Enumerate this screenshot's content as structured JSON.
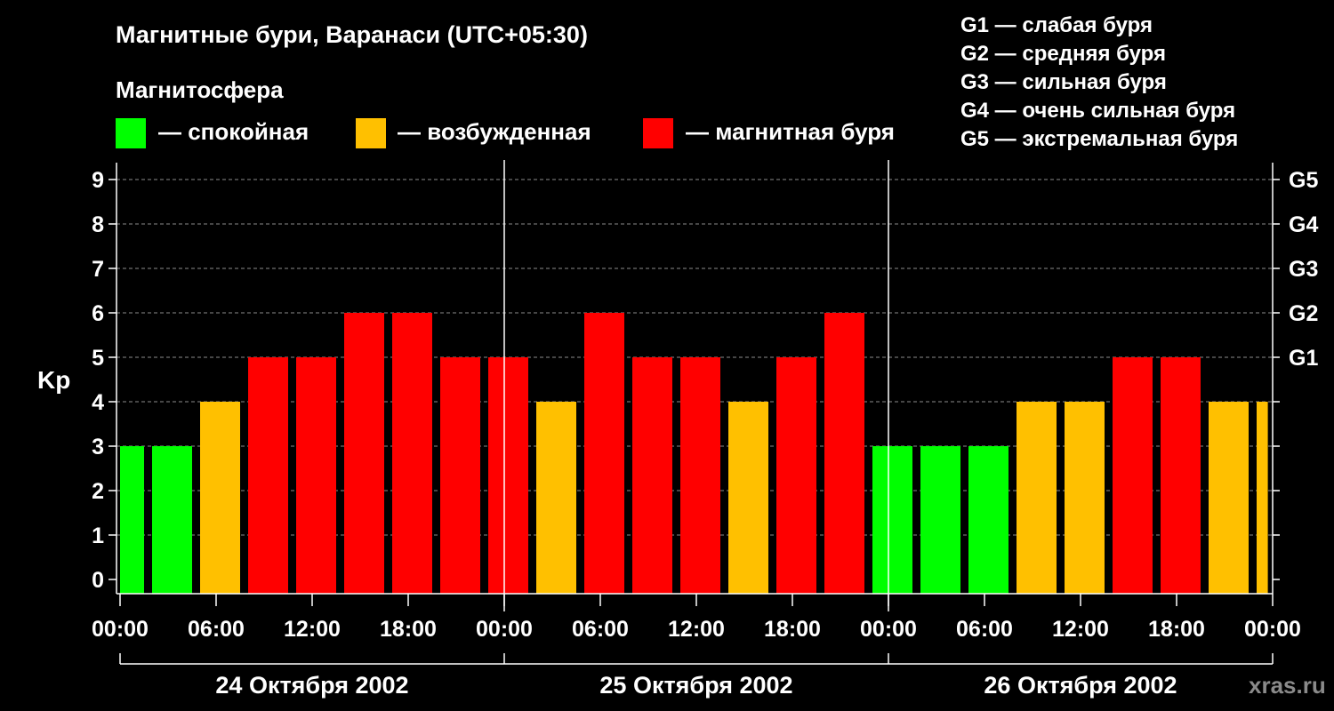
{
  "title": "Магнитные бури, Варанаси (UTC+05:30)",
  "magnetosphere_heading": "Магнитосфера",
  "state_legend": [
    {
      "label": "— спокойная",
      "color": "#00ff00"
    },
    {
      "label": "— возбужденная",
      "color": "#ffc000"
    },
    {
      "label": "— магнитная буря",
      "color": "#ff0000"
    }
  ],
  "storm_legend": [
    "G1 — слабая буря",
    "G2 — средняя буря",
    "G3 — сильная буря",
    "G4 — очень сильная буря",
    "G5 — экстремальная буря"
  ],
  "watermark": "xras.ru",
  "chart_data": {
    "type": "bar",
    "ylabel": "Kp",
    "ylim": [
      0,
      9
    ],
    "yticks": [
      0,
      1,
      2,
      3,
      4,
      5,
      6,
      7,
      8,
      9
    ],
    "right_axis_ticks": [
      {
        "kp": 5,
        "label": "G1"
      },
      {
        "kp": 6,
        "label": "G2"
      },
      {
        "kp": 7,
        "label": "G3"
      },
      {
        "kp": 8,
        "label": "G4"
      },
      {
        "kp": 9,
        "label": "G5"
      }
    ],
    "grid": "horizontal dashed",
    "xlim_hours": [
      0,
      72
    ],
    "xtick_labels": [
      "00:00",
      "06:00",
      "12:00",
      "18:00",
      "00:00",
      "06:00",
      "12:00",
      "18:00",
      "00:00",
      "06:00",
      "12:00",
      "18:00",
      "00:00"
    ],
    "days": [
      "24 Октября 2002",
      "25 Октября 2002",
      "26 Октября 2002"
    ],
    "color_levels": {
      "quiet": "#00ff00",
      "active": "#ffc000",
      "storm": "#ff0000"
    },
    "bars": [
      {
        "start": 0,
        "end": 1.5,
        "kp": 3,
        "level": "quiet"
      },
      {
        "start": 2,
        "end": 4.5,
        "kp": 3,
        "level": "quiet"
      },
      {
        "start": 5,
        "end": 7.5,
        "kp": 4,
        "level": "active"
      },
      {
        "start": 8,
        "end": 10.5,
        "kp": 5,
        "level": "storm"
      },
      {
        "start": 11,
        "end": 13.5,
        "kp": 5,
        "level": "storm"
      },
      {
        "start": 14,
        "end": 16.5,
        "kp": 6,
        "level": "storm"
      },
      {
        "start": 17,
        "end": 19.5,
        "kp": 6,
        "level": "storm"
      },
      {
        "start": 20,
        "end": 22.5,
        "kp": 5,
        "level": "storm"
      },
      {
        "start": 23,
        "end": 25.5,
        "kp": 5,
        "level": "storm"
      },
      {
        "start": 26,
        "end": 28.5,
        "kp": 4,
        "level": "active"
      },
      {
        "start": 29,
        "end": 31.5,
        "kp": 6,
        "level": "storm"
      },
      {
        "start": 32,
        "end": 34.5,
        "kp": 5,
        "level": "storm"
      },
      {
        "start": 35,
        "end": 37.5,
        "kp": 5,
        "level": "storm"
      },
      {
        "start": 38,
        "end": 40.5,
        "kp": 4,
        "level": "active"
      },
      {
        "start": 41,
        "end": 43.5,
        "kp": 5,
        "level": "storm"
      },
      {
        "start": 44,
        "end": 46.5,
        "kp": 6,
        "level": "storm"
      },
      {
        "start": 47,
        "end": 49.5,
        "kp": 3,
        "level": "quiet"
      },
      {
        "start": 50,
        "end": 52.5,
        "kp": 3,
        "level": "quiet"
      },
      {
        "start": 53,
        "end": 55.5,
        "kp": 3,
        "level": "quiet"
      },
      {
        "start": 56,
        "end": 58.5,
        "kp": 4,
        "level": "active"
      },
      {
        "start": 59,
        "end": 61.5,
        "kp": 4,
        "level": "active"
      },
      {
        "start": 62,
        "end": 64.5,
        "kp": 5,
        "level": "storm"
      },
      {
        "start": 65,
        "end": 67.5,
        "kp": 5,
        "level": "storm"
      },
      {
        "start": 68,
        "end": 70.5,
        "kp": 4,
        "level": "active"
      },
      {
        "start": 71,
        "end": 71.7,
        "kp": 4,
        "level": "active"
      }
    ]
  }
}
